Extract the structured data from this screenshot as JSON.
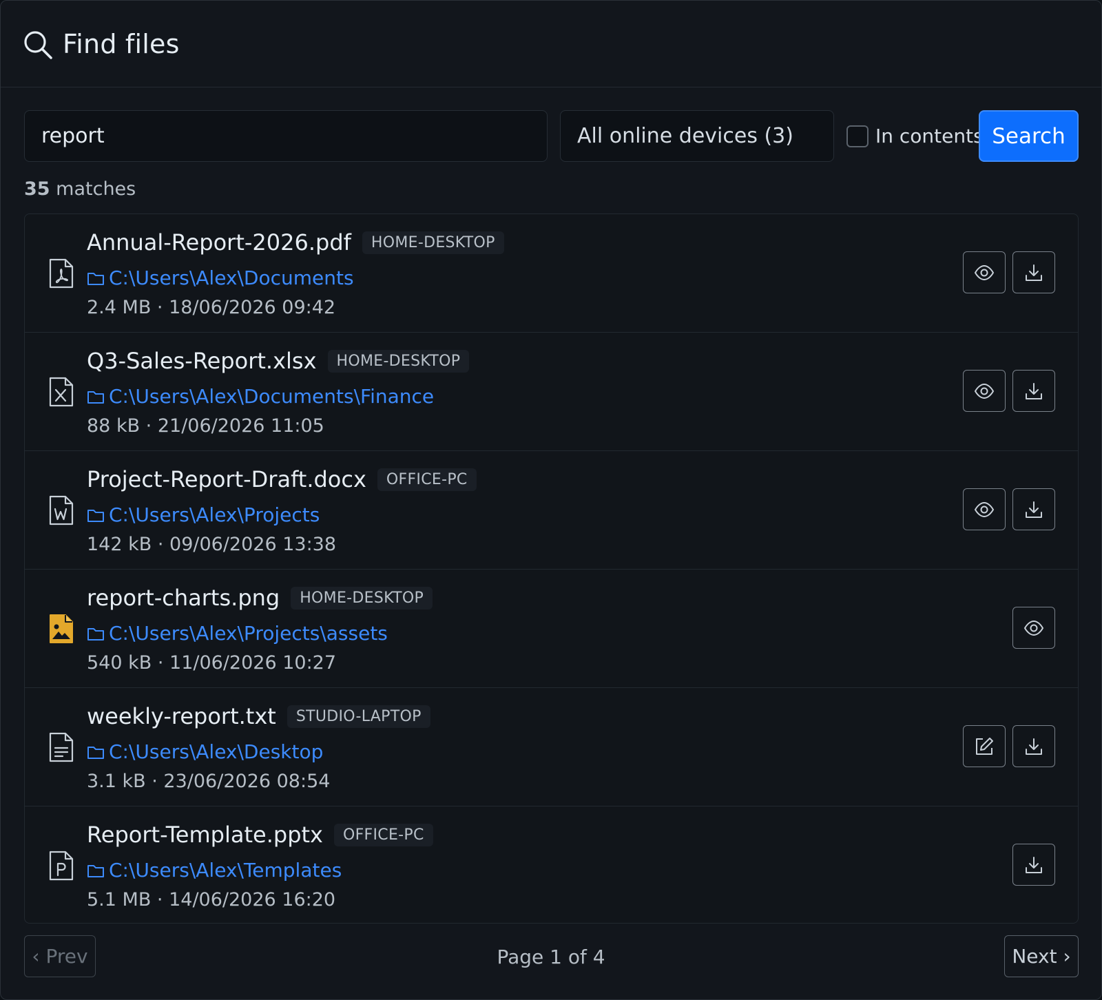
{
  "header": {
    "title": "Find files",
    "icon": "search-icon"
  },
  "search": {
    "value": "report",
    "placeholder": ""
  },
  "device_select": {
    "selected": "All online devices (3)"
  },
  "contents_toggle": {
    "label": "In contents",
    "checked": false
  },
  "search_button": {
    "label": "Search"
  },
  "summary": {
    "count": "35",
    "label": "matches"
  },
  "results": [
    {
      "name": "Annual-Report-2026.pdf",
      "device": "HOME-DESKTOP",
      "path": "C:\\Users\\Alex\\Documents",
      "meta": "2.4 MB · 18/06/2026 09:42",
      "icon": "pdf-file-icon",
      "actions": [
        "preview",
        "download"
      ]
    },
    {
      "name": "Q3-Sales-Report.xlsx",
      "device": "HOME-DESKTOP",
      "path": "C:\\Users\\Alex\\Documents\\Finance",
      "meta": "88 kB · 21/06/2026 11:05",
      "icon": "excel-file-icon",
      "actions": [
        "preview",
        "download"
      ]
    },
    {
      "name": "Project-Report-Draft.docx",
      "device": "OFFICE-PC",
      "path": "C:\\Users\\Alex\\Projects",
      "meta": "142 kB · 09/06/2026 13:38",
      "icon": "word-file-icon",
      "actions": [
        "preview",
        "download"
      ]
    },
    {
      "name": "report-charts.png",
      "device": "HOME-DESKTOP",
      "path": "C:\\Users\\Alex\\Projects\\assets",
      "meta": "540 kB · 11/06/2026 10:27",
      "icon": "image-file-icon",
      "actions": [
        "preview"
      ]
    },
    {
      "name": "weekly-report.txt",
      "device": "STUDIO-LAPTOP",
      "path": "C:\\Users\\Alex\\Desktop",
      "meta": "3.1 kB · 23/06/2026 08:54",
      "icon": "text-file-icon",
      "actions": [
        "edit",
        "download"
      ]
    },
    {
      "name": "Report-Template.pptx",
      "device": "OFFICE-PC",
      "path": "C:\\Users\\Alex\\Templates",
      "meta": "5.1 MB · 14/06/2026 16:20",
      "icon": "powerpoint-file-icon",
      "actions": [
        "download"
      ]
    }
  ],
  "pagination": {
    "prev": "‹ Prev",
    "page": "Page 1 of 4",
    "next": "Next ›"
  },
  "colors": {
    "accent": "#0d6efd",
    "link": "#3d8bfd",
    "background": "#12161c",
    "image_icon": "#e3a82b"
  }
}
